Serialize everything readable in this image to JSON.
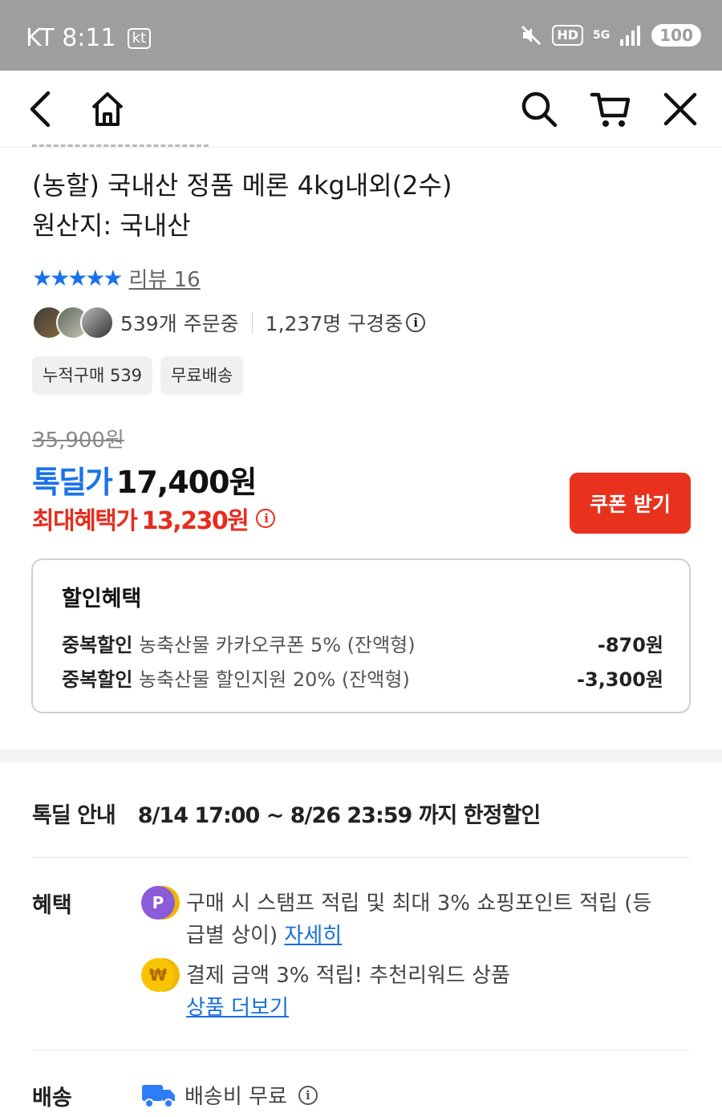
{
  "status_bar": {
    "carrier": "KT",
    "time": "8:11",
    "carrier_badge": "kt",
    "hd": "HD",
    "network": "5G",
    "battery": "100"
  },
  "product": {
    "title_line1": "(농할) 국내산 정품 메론 4kg내외(2수)",
    "title_line2": "원산지: 국내산",
    "stars": "★★★★★",
    "review_link": "리뷰 16",
    "orders": "539개 주문중",
    "viewers": "1,237명 구경중",
    "chips": [
      "누적구매 539",
      "무료배송"
    ]
  },
  "price": {
    "original": "35,900원",
    "deal_label": "톡딜가",
    "deal_price": "17,400원",
    "max_benefit_label": "최대혜택가",
    "max_benefit_price": "13,230원",
    "coupon_button": "쿠폰 받기"
  },
  "discount": {
    "title": "할인혜택",
    "rows": [
      {
        "tag": "중복할인",
        "desc": "농축산물 카카오쿠폰 5% (잔액형)",
        "amount": "-870원"
      },
      {
        "tag": "중복할인",
        "desc": "농축산물 할인지원 20% (잔액형)",
        "amount": "-3,300원"
      }
    ]
  },
  "deal_guide": {
    "label": "톡딜 안내",
    "period": "8/14 17:00 ~ 8/26 23:59 까지 한정할인"
  },
  "benefits": {
    "label": "혜택",
    "items": [
      {
        "icon": "point-coin-icon",
        "icon_text": "P",
        "text": "구매 시 스탬프 적립 및 최대 3% 쇼핑포인트 적립 (등급별 상이) ",
        "link": "자세히"
      },
      {
        "icon": "won-coin-icon",
        "icon_text": "₩",
        "text": "결제 금액 3% 적립! 추천리워드 상품",
        "link": "상품 더보기"
      }
    ]
  },
  "shipping": {
    "label": "배송",
    "text": "배송비 무료"
  },
  "colors": {
    "accent_blue": "#1a73e8",
    "accent_red": "#e8321e",
    "status_bar": "#9e9e9e"
  }
}
